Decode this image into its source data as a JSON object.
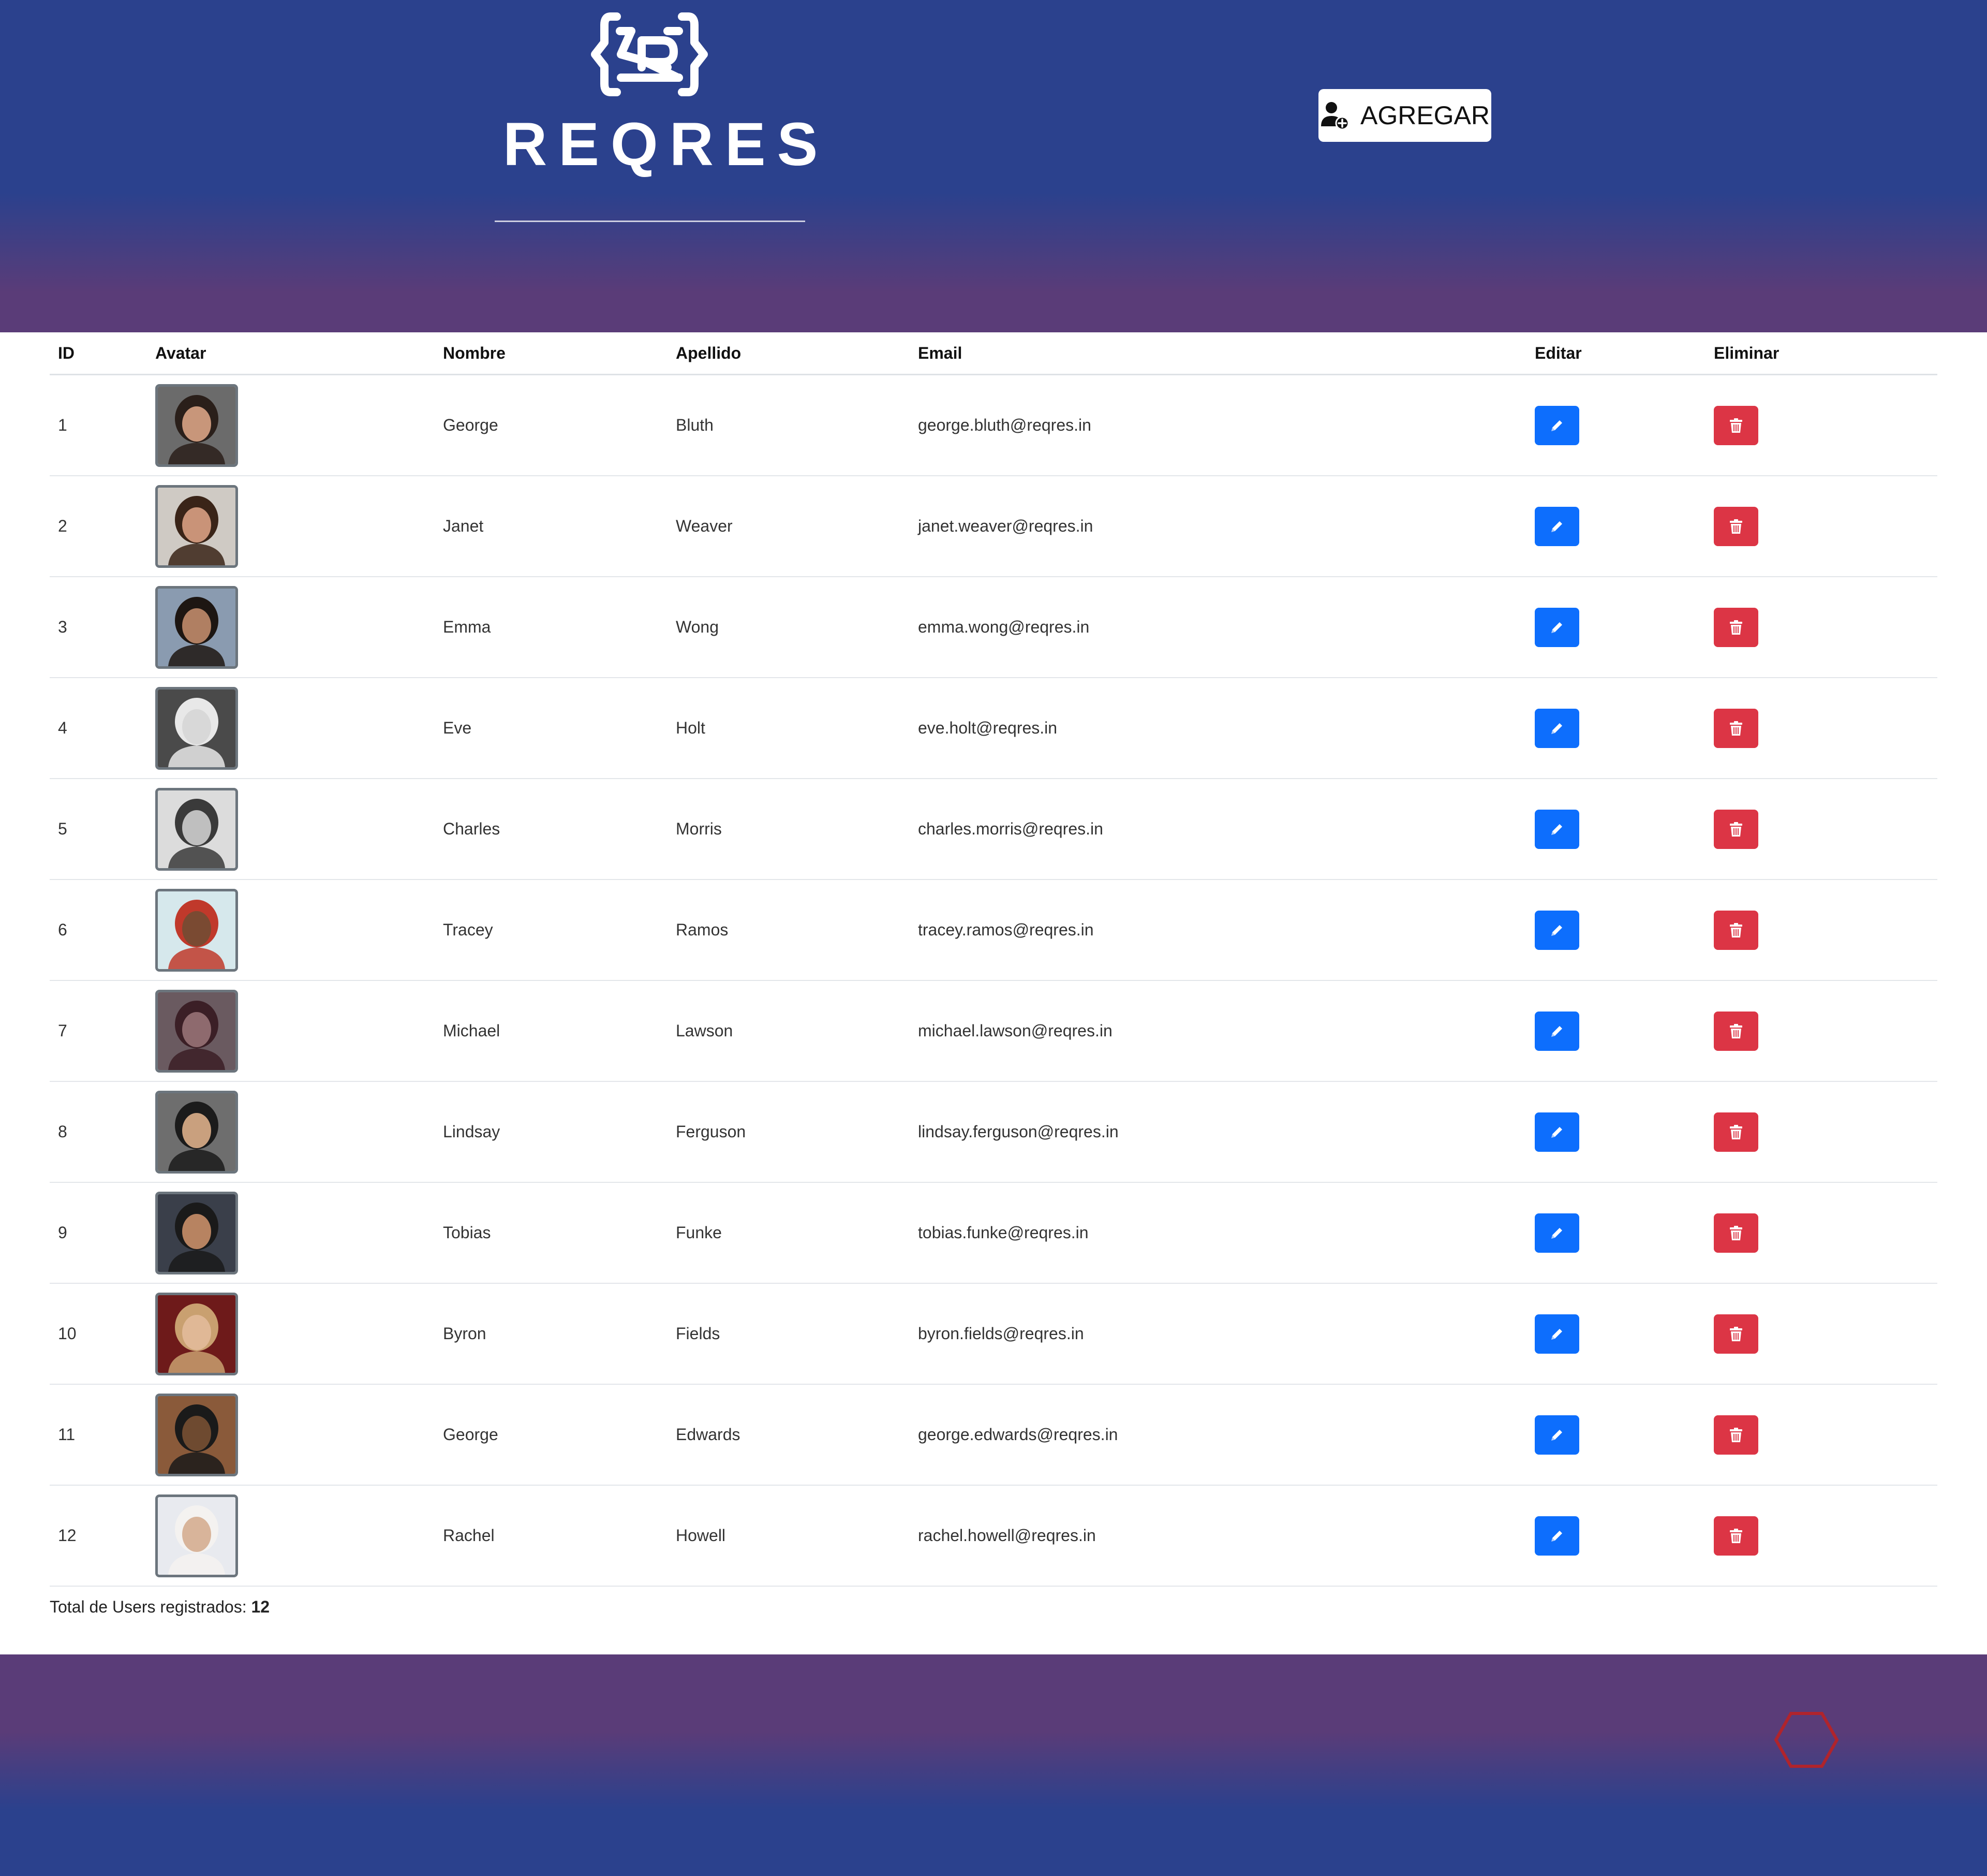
{
  "header": {
    "logo_text": "REQRES",
    "add_button_label": "AGREGAR"
  },
  "table": {
    "columns": [
      "ID",
      "Avatar",
      "Nombre",
      "Apellido",
      "Email",
      "Editar",
      "Eliminar"
    ],
    "rows": [
      {
        "id": "1",
        "first_name": "George",
        "last_name": "Bluth",
        "email": "george.bluth@reqres.in"
      },
      {
        "id": "2",
        "first_name": "Janet",
        "last_name": "Weaver",
        "email": "janet.weaver@reqres.in"
      },
      {
        "id": "3",
        "first_name": "Emma",
        "last_name": "Wong",
        "email": "emma.wong@reqres.in"
      },
      {
        "id": "4",
        "first_name": "Eve",
        "last_name": "Holt",
        "email": "eve.holt@reqres.in"
      },
      {
        "id": "5",
        "first_name": "Charles",
        "last_name": "Morris",
        "email": "charles.morris@reqres.in"
      },
      {
        "id": "6",
        "first_name": "Tracey",
        "last_name": "Ramos",
        "email": "tracey.ramos@reqres.in"
      },
      {
        "id": "7",
        "first_name": "Michael",
        "last_name": "Lawson",
        "email": "michael.lawson@reqres.in"
      },
      {
        "id": "8",
        "first_name": "Lindsay",
        "last_name": "Ferguson",
        "email": "lindsay.ferguson@reqres.in"
      },
      {
        "id": "9",
        "first_name": "Tobias",
        "last_name": "Funke",
        "email": "tobias.funke@reqres.in"
      },
      {
        "id": "10",
        "first_name": "Byron",
        "last_name": "Fields",
        "email": "byron.fields@reqres.in"
      },
      {
        "id": "11",
        "first_name": "George",
        "last_name": "Edwards",
        "email": "george.edwards@reqres.in"
      },
      {
        "id": "12",
        "first_name": "Rachel",
        "last_name": "Howell",
        "email": "rachel.howell@reqres.in"
      }
    ]
  },
  "footer_summary": {
    "label": "Total de Users registrados:",
    "count": "12"
  },
  "icons": {
    "add_user": "user-plus-icon",
    "edit": "pencil-icon",
    "delete": "trash-icon",
    "footer": "hexagon-icon"
  },
  "colors": {
    "header_blue": "#2b418d",
    "header_purple": "#5a3c78",
    "edit_blue": "#0d6efd",
    "delete_red": "#dc3545",
    "hexagon_red": "#b0242c"
  }
}
